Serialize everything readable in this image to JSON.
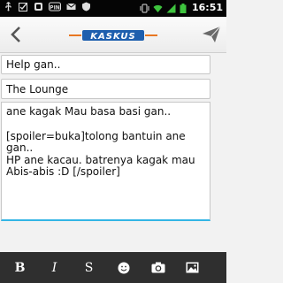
{
  "status_bar": {
    "time": "16:51",
    "left_icons": [
      "usb-icon",
      "checkbox-icon",
      "notification-icon",
      "bbm-icon",
      "mail-icon",
      "shield-icon"
    ],
    "right_icons": [
      "vibrate-icon",
      "wifi-icon",
      "signal-icon",
      "battery-icon"
    ]
  },
  "app_bar": {
    "logo_text": "KASKUS",
    "back_icon": "chevron-left-icon",
    "send_icon": "send-icon"
  },
  "form": {
    "title": "Help gan..",
    "forum": "The Lounge",
    "message_lines": [
      "ane kagak Mau basa basi gan..",
      "",
      "[spoiler=buka]tolong bantuin ane",
      "gan..",
      "HP ane kacau. batrenya kagak mau",
      "Abis-abis :D [/spoiler]"
    ]
  },
  "toolbar": {
    "bold": "B",
    "italic": "I",
    "strike": "S",
    "emoji_icon": "smiley-icon",
    "camera_icon": "camera-icon",
    "image_icon": "image-icon"
  },
  "colors": {
    "accent": "#33b5e5",
    "logo_blue": "#1e5fae",
    "toolbar_bg": "#2f2f2f"
  }
}
